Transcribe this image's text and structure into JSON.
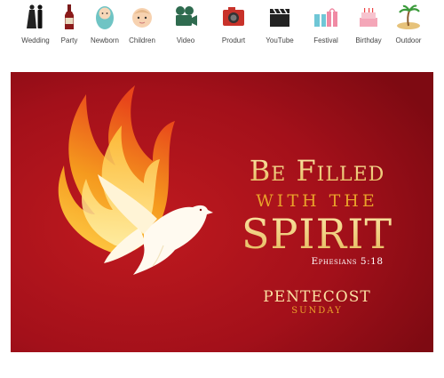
{
  "categories": [
    {
      "label": "Wedding",
      "icon": "wedding-couple-icon"
    },
    {
      "label": "Party",
      "icon": "wine-bottle-icon"
    },
    {
      "label": "Newborn",
      "icon": "baby-icon"
    },
    {
      "label": "Children",
      "icon": "child-face-icon"
    },
    {
      "label": "Video",
      "icon": "film-camera-icon"
    },
    {
      "label": "Produrt",
      "icon": "camera-icon"
    },
    {
      "label": "YouTube",
      "icon": "clapperboard-icon"
    },
    {
      "label": "Festival",
      "icon": "gift-boxes-icon"
    },
    {
      "label": "Birthday",
      "icon": "birthday-cake-icon"
    },
    {
      "label": "Outdoor",
      "icon": "palm-island-icon"
    }
  ],
  "banner": {
    "title_line1": "Be Filled",
    "title_line2": "with the",
    "title_line3": "Spirit",
    "verse": "Ephesians 5:18",
    "event": "Pentecost",
    "event_sub": "Sunday",
    "background_color": "#a3101a",
    "gold_color": "#f2d383"
  }
}
